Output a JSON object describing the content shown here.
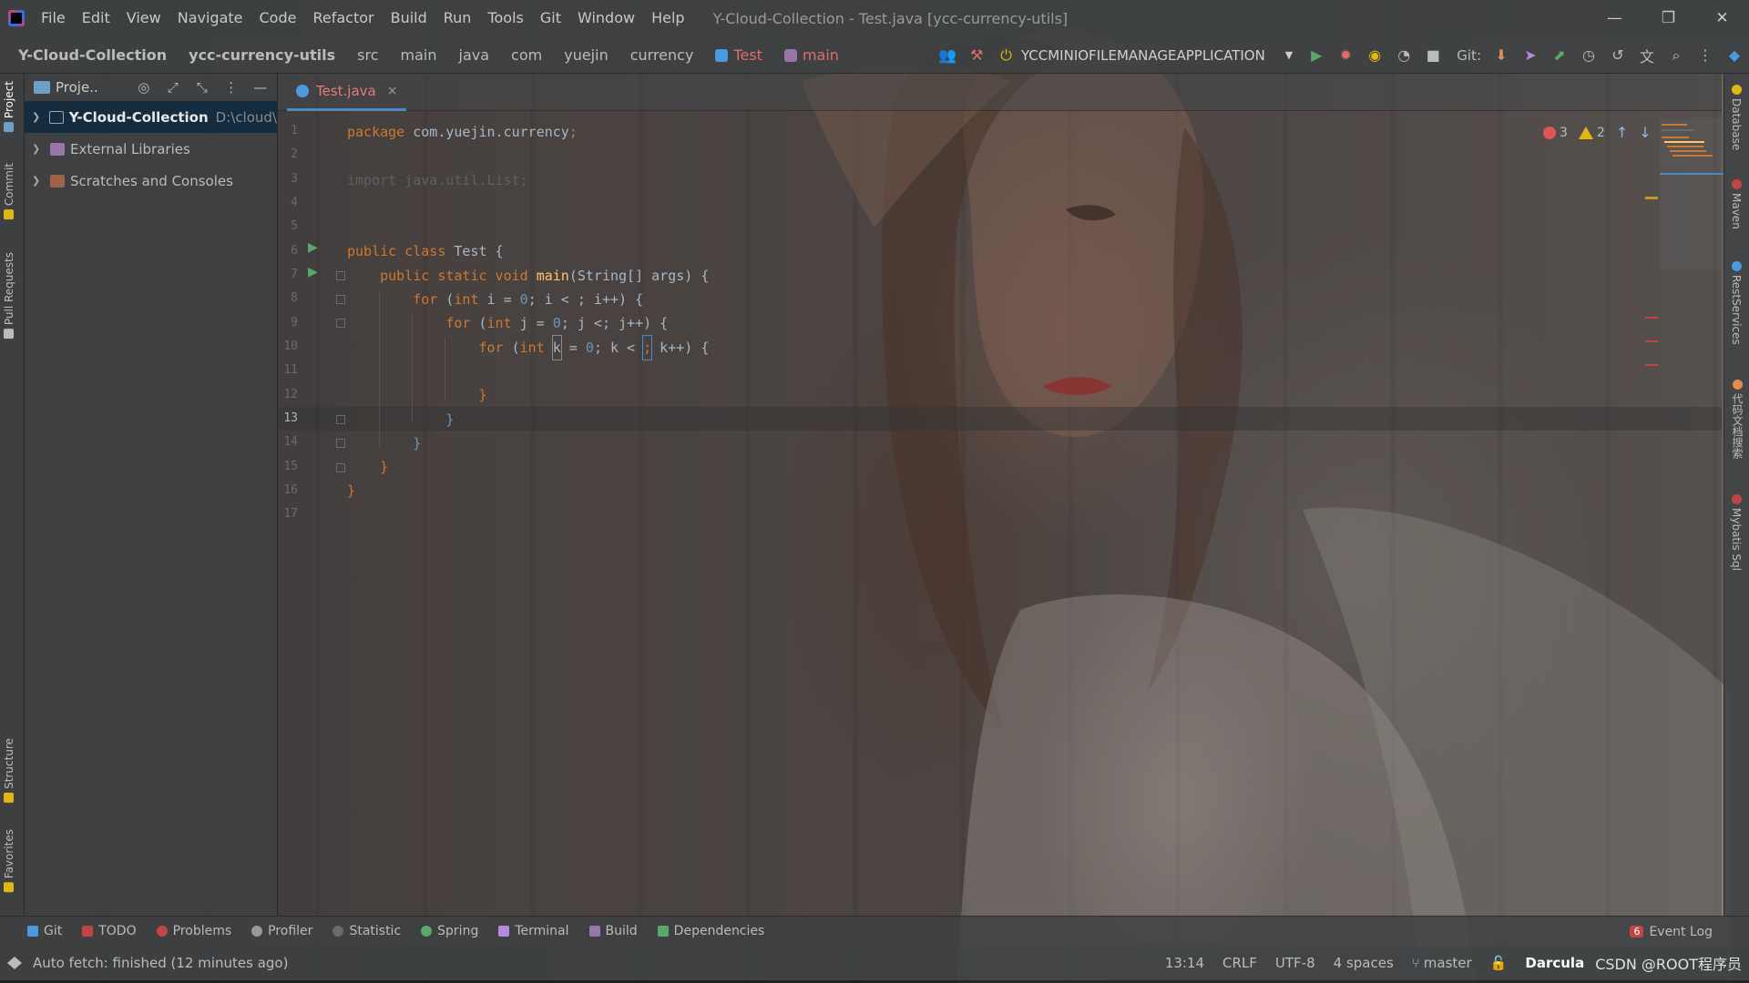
{
  "titlebar": {
    "menu": [
      "File",
      "Edit",
      "View",
      "Navigate",
      "Code",
      "Refactor",
      "Build",
      "Run",
      "Tools",
      "Git",
      "Window",
      "Help"
    ],
    "window_title": "Y-Cloud-Collection - Test.java [ycc-currency-utils]",
    "minimize": "—",
    "restore": "❐",
    "close": "✕"
  },
  "navbar": {
    "crumbs": [
      "Y-Cloud-Collection",
      "ycc-currency-utils",
      "src",
      "main",
      "java",
      "com",
      "yuejin",
      "currency",
      "Test",
      "main"
    ],
    "run_config": "YCCMINIOFILEMANAGEAPPLICATION",
    "git_label": "Git:"
  },
  "left_stripe": {
    "tabs": [
      "Project",
      "Commit",
      "Pull Requests",
      "Structure",
      "Favorites"
    ]
  },
  "project_panel": {
    "header_label": "Proje..",
    "tree": [
      {
        "name": "Y-Cloud-Collection",
        "path": "D:\\cloud\\",
        "selected": true
      },
      {
        "name": "External Libraries",
        "path": "",
        "selected": false
      },
      {
        "name": "Scratches and Consoles",
        "path": "",
        "selected": false
      }
    ]
  },
  "editor": {
    "tab_label": "Test.java",
    "tab_close": "×",
    "line_numbers": [
      "1",
      "2",
      "3",
      "4",
      "5",
      "6",
      "7",
      "8",
      "9",
      "10",
      "11",
      "12",
      "13",
      "14",
      "15",
      "16",
      "17"
    ],
    "current_line": "13",
    "code": {
      "l1_kw": "package",
      "l1_rest": " com.yuejin.currency",
      "l1_semi": ";",
      "l3": "import java.util.List;",
      "l6_kw": "public class",
      "l6_rest": " Test {",
      "l7_kw": "public static void",
      "l7_fn": " main",
      "l7_rest": "(String[] args) {",
      "l8_kw": "for",
      "l8_a": " (",
      "l8_type": "int",
      "l8_b": " i = ",
      "l8_num": "0",
      "l8_c": "; i < ; i++) {",
      "l9_kw": "for",
      "l9_a": " (",
      "l9_type": "int",
      "l9_b": " j = ",
      "l9_num": "0",
      "l9_c": "; j <; j++) {",
      "l10_kw": "for",
      "l10_a": " (",
      "l10_type": "int",
      "l10_b": " ",
      "l10_k": "k",
      "l10_c": " = ",
      "l10_num": "0",
      "l10_d": "; k < ",
      "l10_caret": ";",
      "l10_e": " k++) {",
      "l12": "}",
      "l13": "}",
      "l14": "}",
      "l15": "}",
      "l16": "}"
    },
    "errors": "3",
    "warnings": "2"
  },
  "right_stripe": {
    "tabs": [
      "Database",
      "Maven",
      "RestServices",
      "代码文档搜索",
      "Mybatis Sql"
    ]
  },
  "bottombar": {
    "tabs": [
      "Git",
      "TODO",
      "Problems",
      "Profiler",
      "Statistic",
      "Spring",
      "Terminal",
      "Build",
      "Dependencies"
    ],
    "event_log_badge": "6",
    "event_log": "Event Log"
  },
  "statusbar": {
    "message": "Auto fetch: finished (12 minutes ago)",
    "position": "13:14",
    "line_sep": "CRLF",
    "encoding": "UTF-8",
    "indent": "4 spaces",
    "branch": "master",
    "theme": "Darcula",
    "watermark": "CSDN @ROOT程序员"
  },
  "colors": {
    "keyword": "#cc7832",
    "number": "#6897bb",
    "function": "#ffc66d",
    "plain": "#a9b7c6",
    "error": "#c24545",
    "warning": "#e2b714",
    "run": "#59a869"
  }
}
